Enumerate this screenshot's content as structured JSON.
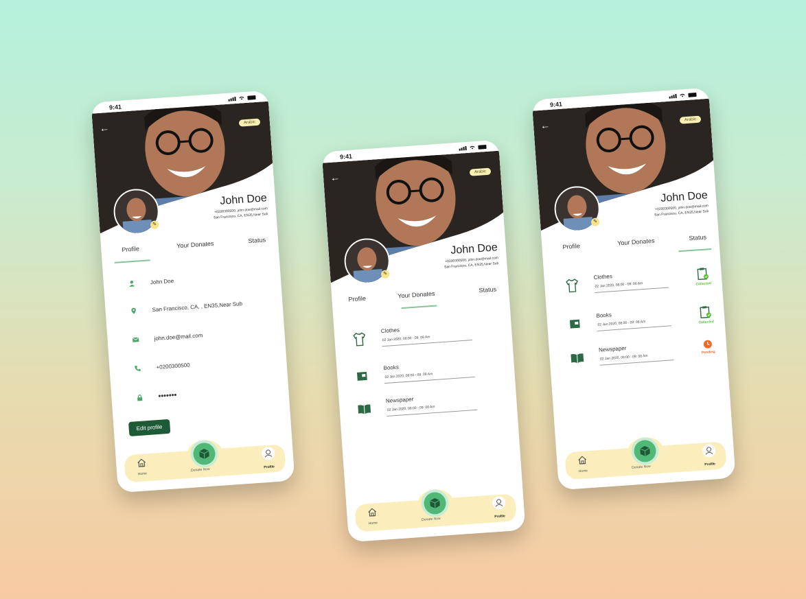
{
  "status": {
    "time": "9:41"
  },
  "profile": {
    "language_badge": "Arabic",
    "name": "John Doe",
    "contact_line": "+0200300500, john.doe@mail.com",
    "address_line": "San Francisco, CA, EN35,Near Sub"
  },
  "tabs": [
    "Profile",
    "Your Donates",
    "Status"
  ],
  "profile_fields": {
    "name": "John Doe",
    "address": "San Francisco, CA, , EN35,Near Sub",
    "email": "john.doe@mail.com",
    "phone": "+0200300500",
    "password": "•••••••"
  },
  "edit_button": "Edit profile",
  "donations": [
    {
      "title": "Clothes",
      "date": "02 Jan 2020,  08:00 - 09: 08 Am",
      "status": "Collected"
    },
    {
      "title": "Books",
      "date": "02 Jan 2020,  08:00 - 09: 08 Am",
      "status": "Collected"
    },
    {
      "title": "Newspaper",
      "date": "02 Jan 2020,  08:00 - 09: 08 Am",
      "status": "Pending"
    }
  ],
  "nav": {
    "home": "Home",
    "donate": "Donate Now",
    "profile": "Profile"
  },
  "colors": {
    "accent": "#1f5a36",
    "green": "#4aa86a",
    "nav_bg": "#fbeebc",
    "pending": "#f06a2a"
  }
}
